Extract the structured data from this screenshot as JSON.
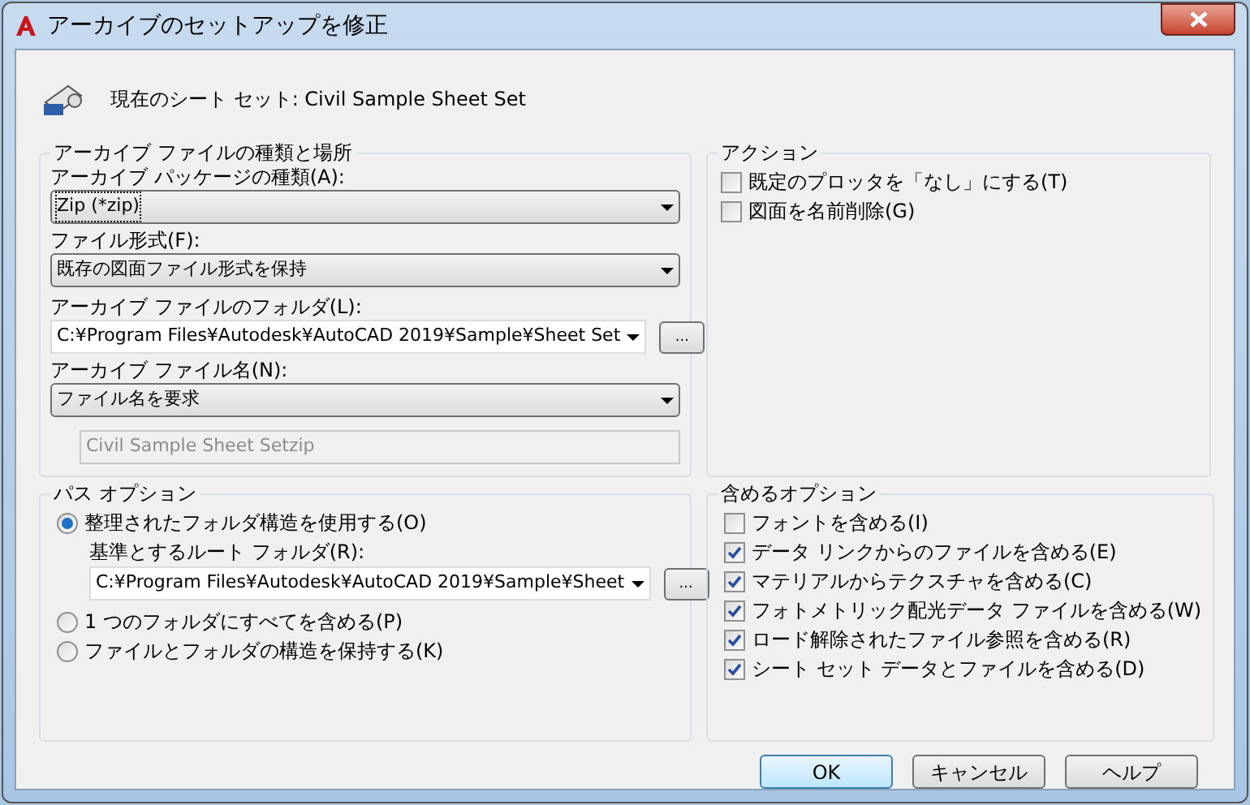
{
  "window": {
    "title": "アーカイブのセットアップを修正"
  },
  "header": {
    "text": "現在のシート セット: Civil Sample Sheet Set"
  },
  "archive_group": {
    "title": "アーカイブ ファイルの種類と場所",
    "fields": [
      {
        "kind": "select",
        "label": "アーカイブ パッケージの種類(A):",
        "value": "Zip (*zip)",
        "focused": true
      },
      {
        "kind": "select",
        "label": "ファイル形式(F):",
        "value": "既存の図面ファイル形式を保持",
        "focused": false
      },
      {
        "kind": "combo",
        "label": "アーカイブ ファイルのフォルダ(L):",
        "value": "C:¥Program Files¥Autodesk¥AutoCAD 2019¥Sample¥Sheet Set",
        "browse": "..."
      },
      {
        "kind": "select",
        "label": "アーカイブ ファイル名(N):",
        "value": "ファイル名を要求",
        "focused": false
      },
      {
        "kind": "text",
        "value": "Civil Sample Sheet Setzip",
        "disabled": true
      }
    ]
  },
  "actions_group": {
    "title": "アクション",
    "items": [
      {
        "label": "既定のプロッタを「なし」にする(T)",
        "checked": false
      },
      {
        "label": "図面を名前削除(G)",
        "checked": false
      }
    ]
  },
  "path_group": {
    "title": "パス オプション",
    "options": [
      {
        "label": "整理されたフォルダ構造を使用する(O)",
        "selected": true,
        "sub": {
          "label": "基準とするルート フォルダ(R):",
          "value": "C:¥Program Files¥Autodesk¥AutoCAD 2019¥Sample¥Sheet",
          "browse": "..."
        }
      },
      {
        "label": "1 つのフォルダにすべてを含める(P)",
        "selected": false
      },
      {
        "label": "ファイルとフォルダの構造を保持する(K)",
        "selected": false
      }
    ]
  },
  "include_group": {
    "title": "含めるオプション",
    "items": [
      {
        "label": "フォントを含める(I)",
        "checked": false
      },
      {
        "label": "データ リンクからのファイルを含める(E)",
        "checked": true
      },
      {
        "label": "マテリアルからテクスチャを含める(C)",
        "checked": true
      },
      {
        "label": "フォトメトリック配光データ ファイルを含める(W)",
        "checked": true
      },
      {
        "label": "ロード解除されたファイル参照を含める(R)",
        "checked": true
      },
      {
        "label": "シート セット データとファイルを含める(D)",
        "checked": true
      }
    ]
  },
  "buttons": [
    {
      "label": "OK",
      "default": true
    },
    {
      "label": "キャンセル",
      "default": false
    },
    {
      "label": "ヘルプ",
      "default": false
    }
  ]
}
